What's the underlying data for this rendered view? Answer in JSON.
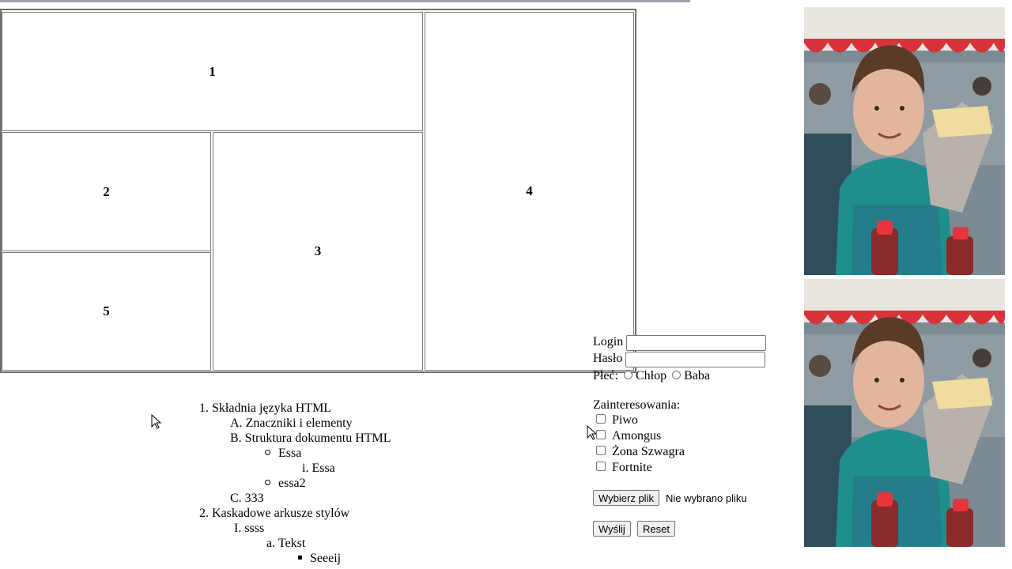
{
  "layout_table": {
    "cells": [
      "1",
      "2",
      "3",
      "4",
      "5"
    ]
  },
  "outline": {
    "item1": {
      "number": "1.",
      "label": "Składnia języka HTML"
    },
    "item1a": {
      "number": "A.",
      "label": "Znaczniki i elementy"
    },
    "item1b": {
      "number": "B.",
      "label": "Struktura dokumentu HTML"
    },
    "item1b_bullet1": {
      "label": "Essa"
    },
    "item1b_sub_i": {
      "number": "i.",
      "label": "Essa"
    },
    "item1b_bullet2": {
      "label": "essa2"
    },
    "item1c": {
      "number": "C.",
      "label": "333"
    },
    "item2": {
      "number": "2.",
      "label": "Kaskadowe arkusze stylów"
    },
    "item2_I": {
      "number": "I.",
      "label": "ssss"
    },
    "item2_a": {
      "number": "a.",
      "label": "Tekst"
    },
    "item2_square": {
      "label": "Seeeij"
    }
  },
  "form": {
    "login_label": "Login",
    "login_value": "",
    "password_label": "Hasło",
    "password_value": "",
    "gender_label": "Płeć:",
    "gender_options": [
      "Chłop",
      "Baba"
    ],
    "interests_label": "Zainteresowania:",
    "interests": [
      "Piwo",
      "Amongus",
      "Żona Szwagra",
      "Fortnite"
    ],
    "file_button": "Wybierz plik",
    "file_status": "Nie wybrano pliku",
    "submit_button": "Wyślij",
    "reset_button": "Reset"
  },
  "photos": {
    "count": 2
  }
}
